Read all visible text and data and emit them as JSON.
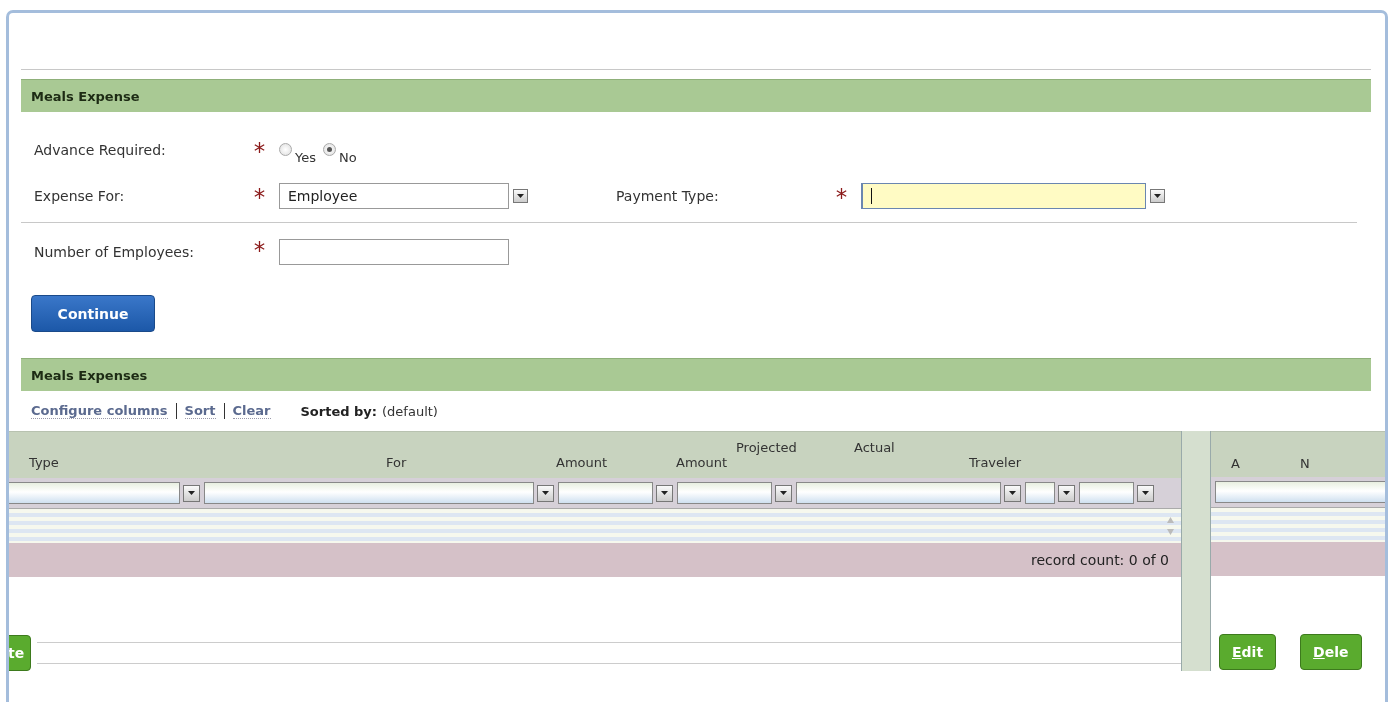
{
  "form": {
    "title": "Meals Expense",
    "rows": [
      {
        "fields": [
          {
            "kind": "radio",
            "label": "Advance Required:",
            "required": true,
            "options": [
              {
                "label": "Yes",
                "selected": false
              },
              {
                "label": "No",
                "selected": true
              }
            ]
          }
        ]
      },
      {
        "fields": [
          {
            "kind": "select",
            "label": "Expense For:",
            "required": true,
            "value": "Employee",
            "focused": false
          },
          {
            "kind": "select",
            "label": "Payment Type:",
            "required": true,
            "focused": true
          }
        ]
      },
      {
        "fields": [
          {
            "kind": "text",
            "label": "Number of Employees:",
            "required": true,
            "focused": false
          }
        ]
      }
    ],
    "button": "Continue"
  },
  "grid": {
    "title": "Meals Expenses",
    "links": [
      "Configure columns",
      "Sort",
      "Clear"
    ],
    "sorted_by_label": "Sorted by:",
    "sorted_by_value": "(default)",
    "columns": [
      {
        "label": "Type"
      },
      {
        "label": "For"
      },
      {
        "label": "Amount"
      },
      {
        "label": "Projected"
      },
      {
        "label": "Amount"
      },
      {
        "label": "Actual"
      },
      {
        "label": "Traveler"
      },
      {
        "label": "A"
      },
      {
        "label": "N"
      }
    ],
    "record_count": "record count: 0 of 0",
    "buttons": [
      {
        "label": "te",
        "mnemonic": false
      },
      {
        "label": "Edit",
        "mnemonic": true
      },
      {
        "label": "Dele",
        "mnemonic": true
      }
    ]
  }
}
